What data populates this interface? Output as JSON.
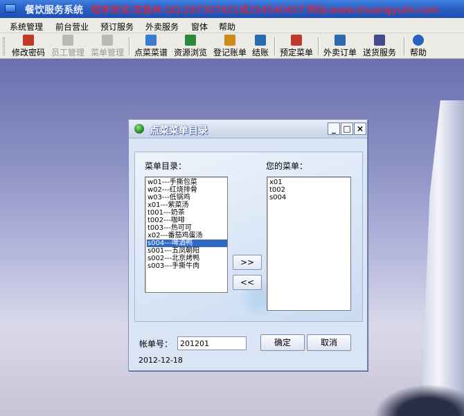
{
  "app": {
    "title": "餐饮服务系统",
    "promo": "程序测试:双鱼林 QQ:287307421或254540457 网站:www.shuangyulin.com"
  },
  "menubar": [
    "系统管理",
    "前台营业",
    "预订服务",
    "外卖服务",
    "窗体",
    "帮助"
  ],
  "toolbar": [
    {
      "label": "修改密码",
      "icon": "key-icon",
      "color": "#c0392b",
      "enabled": true
    },
    {
      "label": "员工管理",
      "icon": "people-icon",
      "color": "#888888",
      "enabled": false
    },
    {
      "label": "菜单管理",
      "icon": "menu-book-icon",
      "color": "#888888",
      "enabled": false
    },
    {
      "label": "点菜菜谱",
      "icon": "recipe-icon",
      "color": "#3a7bd5",
      "enabled": true
    },
    {
      "label": "资源浏览",
      "icon": "browse-icon",
      "color": "#2a8a3a",
      "enabled": true
    },
    {
      "label": "登记账单",
      "icon": "register-bill-icon",
      "color": "#d08a1a",
      "enabled": true
    },
    {
      "label": "结账",
      "icon": "checkout-icon",
      "color": "#2a6ab0",
      "enabled": true
    },
    {
      "label": "预定菜单",
      "icon": "reserve-icon",
      "color": "#c0392b",
      "enabled": true
    },
    {
      "label": "外卖订单",
      "icon": "takeout-icon",
      "color": "#2a6ab0",
      "enabled": true
    },
    {
      "label": "送货服务",
      "icon": "delivery-icon",
      "color": "#444a8a",
      "enabled": true
    },
    {
      "label": "帮助",
      "icon": "help-icon",
      "color": "#2a5fc4",
      "enabled": true
    }
  ],
  "dialog": {
    "title": "点菜菜单目录",
    "menu_label": "菜单目录：",
    "yours_label": "您的菜单：",
    "menu_items": [
      "w01---手撕包菜",
      "w02---红烧排骨",
      "w03---低锅鸡",
      "x01---紫菜汤",
      "t001---奶茶",
      "t002---咖啡",
      "t003---热可可",
      "x02---番茄鸡蛋汤",
      "s004---啤酒鸭",
      "s001---五凤朝阳",
      "s002---北京烤鸭",
      "s003---手撕牛肉"
    ],
    "selected_item": "s004---啤酒鸭",
    "your_items": [
      "x01",
      "t002",
      "s004"
    ],
    "add_label": ">>",
    "remove_label": "<<",
    "bill_label": "帐单号：",
    "bill_no": "201201",
    "ok_label": "确定",
    "cancel_label": "取消",
    "date": "2012-12-18"
  }
}
